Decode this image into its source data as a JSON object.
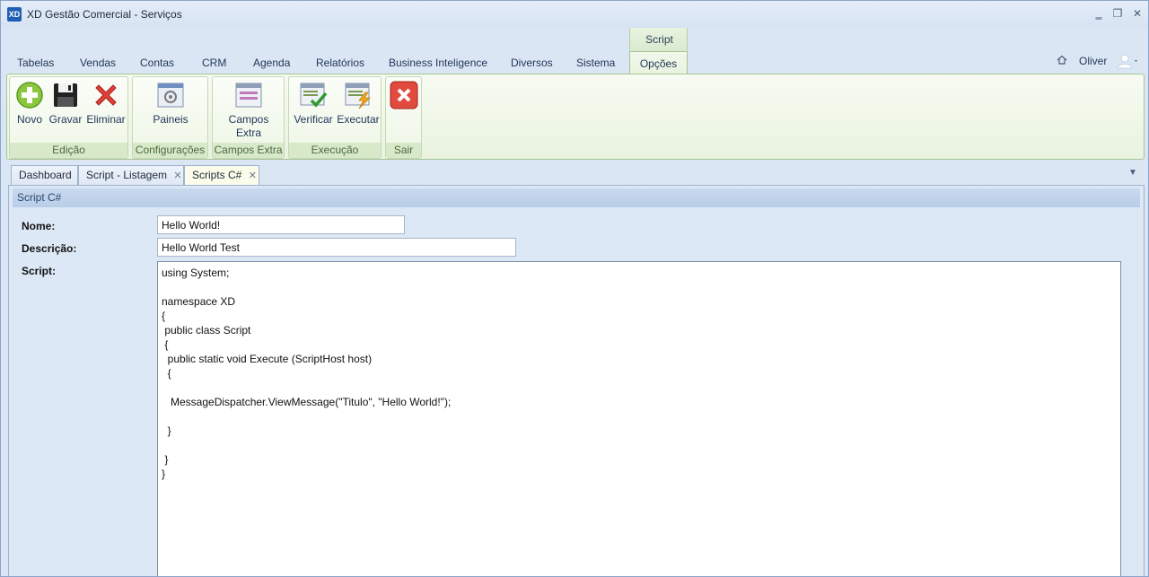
{
  "window": {
    "title": "XD Gestão Comercial - Serviços",
    "logo_text": "XD",
    "minimize": "‗",
    "restore": "❐",
    "close": "✕"
  },
  "ribbon_tabs": [
    {
      "label": "Tabelas"
    },
    {
      "label": "Vendas"
    },
    {
      "label": "Contas"
    },
    {
      "label": "CRM"
    },
    {
      "label": "Agenda"
    },
    {
      "label": "Relatórios"
    },
    {
      "label": "Business Inteligence"
    },
    {
      "label": "Diversos"
    },
    {
      "label": "Sistema"
    }
  ],
  "contextual_group": {
    "label": "Script",
    "active_tab": "Opções"
  },
  "user": {
    "name": "Oliver"
  },
  "ribbon_groups": {
    "edicao": {
      "label": "Edição",
      "novo": "Novo",
      "gravar": "Gravar",
      "eliminar": "Eliminar"
    },
    "configuracoes": {
      "label": "Configurações",
      "paineis": "Paineis"
    },
    "campos_extra": {
      "label": "Campos Extra",
      "campos_line1": "Campos",
      "campos_line2": "Extra"
    },
    "execucao": {
      "label": "Execução",
      "verificar": "Verificar",
      "executar": "Executar"
    },
    "sair": {
      "label": "Sair"
    }
  },
  "doc_tabs": {
    "dashboard": "Dashboard",
    "listagem": "Script - Listagem",
    "scripts": "Scripts C#",
    "close_glyph": "✕"
  },
  "panel": {
    "header": "Script C#",
    "nome_label": "Nome:",
    "nome_value": "Hello World!",
    "descricao_label": "Descrição:",
    "descricao_value": "Hello World Test",
    "script_label": "Script:",
    "script_code": "using System;\n\nnamespace XD\n{\n public class Script\n {\n  public static void Execute (ScriptHost host)\n  {\n\n   MessageDispatcher.ViewMessage(\"Titulo\", \"Hello World!\");\n\n  }\n\n }\n}"
  },
  "colors": {
    "accent_blue": "#1f5fb3",
    "ribbon_green": "#e9f3df",
    "panel_header": "#c9d9ee"
  }
}
